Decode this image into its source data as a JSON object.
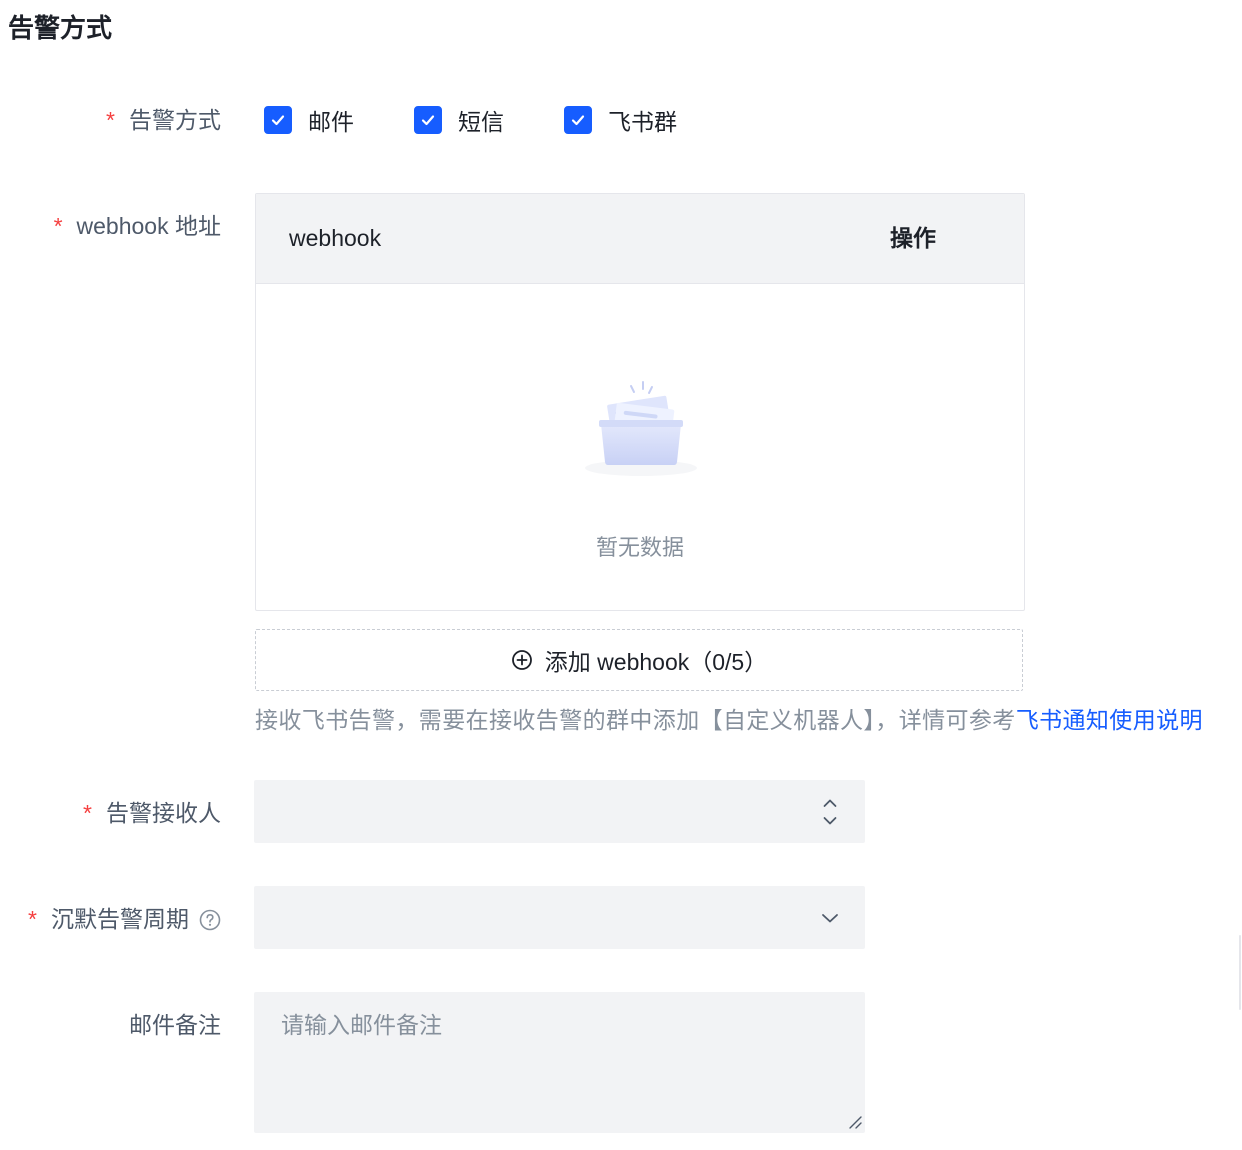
{
  "section": {
    "title": "告警方式"
  },
  "form": {
    "required_mark": "*",
    "alert_method": {
      "label": "告警方式",
      "required": true,
      "options": [
        {
          "label": "邮件",
          "checked": true
        },
        {
          "label": "短信",
          "checked": true
        },
        {
          "label": "飞书群",
          "checked": true
        }
      ]
    },
    "webhook": {
      "label": "webhook 地址",
      "required": true,
      "table": {
        "columns": [
          "webhook",
          "操作"
        ],
        "rows": [],
        "empty_text": "暂无数据",
        "empty_icon": "empty-box-icon"
      },
      "add_button": {
        "icon": "plus-circle-icon",
        "label": "添加 webhook（0/5）"
      },
      "help": {
        "text": "接收飞书告警，需要在接收告警的群中添加【自定义机器人】，详情可参考",
        "link_text": "飞书通知使用说明"
      }
    },
    "receivers": {
      "label": "告警接收人",
      "required": true,
      "value": "",
      "icon": "up-down-arrows-icon"
    },
    "silence_period": {
      "label": "沉默告警周期",
      "required": true,
      "value": "",
      "help_icon": "question-circle-icon",
      "icon": "chevron-down-icon"
    },
    "email_note": {
      "label": "邮件备注",
      "required": false,
      "value": "",
      "placeholder": "请输入邮件备注"
    }
  },
  "colors": {
    "primary": "#165dff",
    "required": "#f53f3f",
    "text": "#1d2129",
    "label": "#4e5969",
    "muted": "#86909c",
    "fill": "#f2f3f5",
    "border": "#e5e6eb"
  }
}
